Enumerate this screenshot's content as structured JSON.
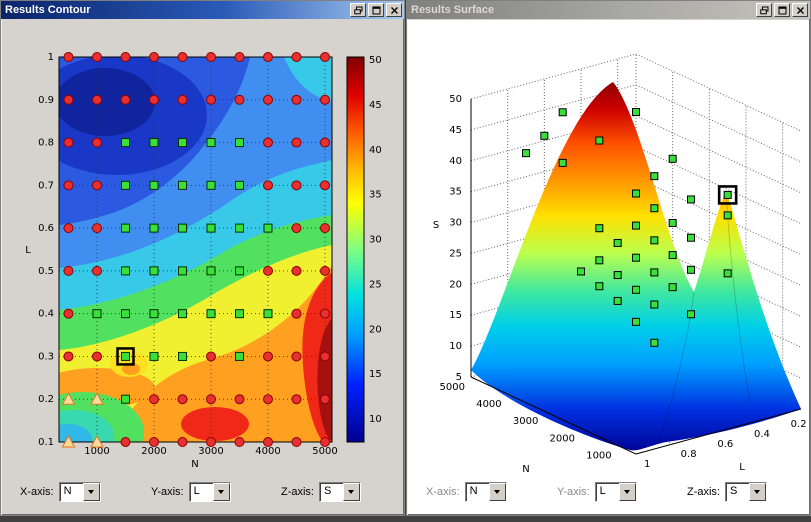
{
  "app": {
    "left_window": {
      "title": "Results Contour",
      "active": true,
      "titlebar_buttons": [
        "dock-icon",
        "maximize-icon",
        "close-icon"
      ],
      "controls": [
        {
          "label": "X-axis:",
          "value": "N",
          "disabled": false
        },
        {
          "label": "Y-axis:",
          "value": "L",
          "disabled": false
        },
        {
          "label": "Z-axis:",
          "value": "S",
          "disabled": false
        }
      ]
    },
    "right_window": {
      "title": "Results Surface",
      "active": false,
      "titlebar_buttons": [
        "dock-icon",
        "maximize-icon",
        "close-icon"
      ],
      "controls": [
        {
          "label": "X-axis:",
          "value": "N",
          "disabled": true
        },
        {
          "label": "Y-axis:",
          "value": "L",
          "disabled": true
        },
        {
          "label": "Z-axis:",
          "value": "S",
          "disabled": false
        }
      ]
    }
  },
  "chart_data": [
    {
      "type": "heatmap",
      "subtype": "filled-contour",
      "title": "Results Contour",
      "colormap": "jet",
      "xlabel": "N",
      "ylabel": "L",
      "x_ticks": [
        1000,
        2000,
        3000,
        4000,
        5000
      ],
      "y_ticks": [
        0.1,
        0.2,
        0.3,
        0.4,
        0.5,
        0.6,
        0.7,
        0.8,
        0.9,
        1
      ],
      "xlim": [
        250,
        5100
      ],
      "ylim": [
        0.1,
        1.0
      ],
      "grid": true,
      "colorbar": {
        "ticks": [
          50,
          45,
          40,
          35,
          30,
          25,
          20,
          15,
          10
        ],
        "range": [
          8,
          50
        ],
        "position": "right"
      },
      "marker_legend": {
        "C": "red-circle",
        "G": "green-square",
        "T": "orange-triangle",
        "H": "highlighted-green-square"
      },
      "marker_grid": {
        "x_values": [
          500,
          1000,
          1500,
          2000,
          2500,
          3000,
          3500,
          4000,
          4500,
          5000
        ],
        "y_values": [
          1.0,
          0.9,
          0.8,
          0.7,
          0.6,
          0.5,
          0.4,
          0.3,
          0.2,
          0.1
        ],
        "rows": [
          "CCCCCCCCCC",
          "CCCCCCCCCC",
          "CCGGGGGCCC",
          "CCGGGGGCCC",
          "CCGGGGGGCC",
          "CCGGGGGCCC",
          "CGGGGGGGCC",
          "CCHGGCGCCC",
          "TTGCCCCCCC",
          "TTCCCCCCCC"
        ]
      },
      "highlight_point": {
        "N": 1500,
        "L": 0.3
      }
    },
    {
      "type": "surface",
      "title": "Results Surface",
      "colormap": "jet",
      "xlabel": "N",
      "ylabel": "L",
      "zlabel": "S",
      "x_ticks": [
        5000,
        4000,
        3000,
        2000,
        1000
      ],
      "y_ticks": [
        1,
        0.8,
        0.6,
        0.4,
        0.2
      ],
      "z_ticks": [
        5,
        10,
        15,
        20,
        25,
        30,
        35,
        40,
        45,
        50
      ],
      "zlim": [
        5,
        50
      ],
      "grid": true,
      "marker": {
        "shape": "green-square",
        "fill": "#3ae03a"
      },
      "markers": [
        {
          "N": 4500,
          "L": 0.6,
          "S": 46
        },
        {
          "N": 4500,
          "L": 0.7,
          "S": 43
        },
        {
          "N": 4000,
          "L": 0.7,
          "S": 40
        },
        {
          "N": 4500,
          "L": 0.8,
          "S": 41
        },
        {
          "N": 4000,
          "L": 0.5,
          "S": 42
        },
        {
          "N": 4000,
          "L": 0.3,
          "S": 45
        },
        {
          "N": 3500,
          "L": 0.2,
          "S": 38
        },
        {
          "N": 3500,
          "L": 0.4,
          "S": 34
        },
        {
          "N": 3000,
          "L": 0.4,
          "S": 33
        },
        {
          "N": 2500,
          "L": 0.4,
          "S": 32
        },
        {
          "N": 2000,
          "L": 0.4,
          "S": 31
        },
        {
          "N": 3500,
          "L": 0.3,
          "S": 36
        },
        {
          "N": 2500,
          "L": 0.3,
          "S": 35
        },
        {
          "N": 1500,
          "L": 0.5,
          "S": 28
        },
        {
          "N": 2000,
          "L": 0.5,
          "S": 29
        },
        {
          "N": 2500,
          "L": 0.5,
          "S": 30
        },
        {
          "N": 3000,
          "L": 0.5,
          "S": 31
        },
        {
          "N": 1500,
          "L": 0.6,
          "S": 26
        },
        {
          "N": 2000,
          "L": 0.6,
          "S": 27
        },
        {
          "N": 2500,
          "L": 0.6,
          "S": 28
        },
        {
          "N": 3000,
          "L": 0.6,
          "S": 29
        },
        {
          "N": 3500,
          "L": 0.6,
          "S": 30
        },
        {
          "N": 1500,
          "L": 0.7,
          "S": 24
        },
        {
          "N": 2000,
          "L": 0.7,
          "S": 25
        },
        {
          "N": 2500,
          "L": 0.7,
          "S": 26
        },
        {
          "N": 3000,
          "L": 0.7,
          "S": 27
        },
        {
          "N": 1500,
          "L": 0.8,
          "S": 22
        },
        {
          "N": 2000,
          "L": 0.8,
          "S": 24
        },
        {
          "N": 2500,
          "L": 0.8,
          "S": 25
        },
        {
          "N": 3000,
          "L": 0.8,
          "S": 26
        },
        {
          "N": 2000,
          "L": 0.2,
          "S": 33
        },
        {
          "N": 1000,
          "L": 0.6,
          "S": 23
        },
        {
          "N": 1000,
          "L": 0.4,
          "S": 28
        },
        {
          "N": 1000,
          "L": 0.8,
          "S": 20
        }
      ],
      "highlight_point": {
        "N": 1500,
        "L": 0.3,
        "S": 38.5
      }
    }
  ]
}
